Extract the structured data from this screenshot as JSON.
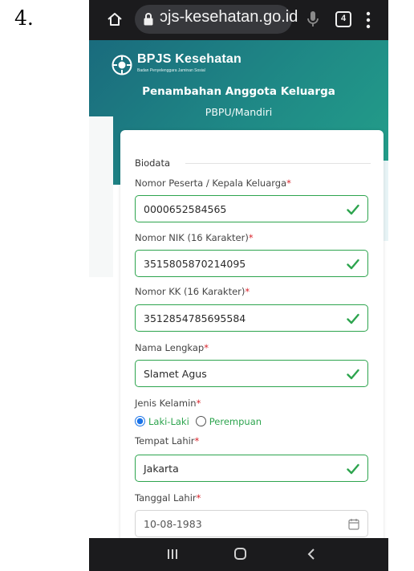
{
  "step_number": "4.",
  "browser": {
    "url": " ɔjs-kesehatan.go.id",
    "tab_count": "4"
  },
  "header": {
    "logo_name": "BPJS Kesehatan",
    "logo_tagline": "Badan Penyelenggara Jaminan Sosial",
    "title": "Penambahan Anggota Keluarga",
    "subtitle": "PBPU/Mandiri"
  },
  "form": {
    "legend": "Biodata",
    "fields": [
      {
        "label": "Nomor Peserta / Kepala Keluarga",
        "required": "*",
        "value": "0000652584565"
      },
      {
        "label": "Nomor NIK (16 Karakter)",
        "required": "*",
        "value": "3515805870214095"
      },
      {
        "label": "Nomor KK (16 Karakter)",
        "required": "*",
        "value": "3512854785695584"
      },
      {
        "label": "Nama Lengkap",
        "required": "*",
        "value": "Slamet Agus"
      }
    ],
    "gender": {
      "label": "Jenis Kelamin",
      "required": "*",
      "options": [
        "Laki-Laki",
        "Perempuan"
      ],
      "selected": "Laki-Laki"
    },
    "birthplace": {
      "label": "Tempat Lahir",
      "required": "*",
      "value": "Jakarta"
    },
    "birthdate": {
      "label": "Tanggal Lahir",
      "required": "*",
      "value": "10-08-1983"
    }
  },
  "colors": {
    "accent_green": "#2da44e",
    "header_teal": "#1f8a86",
    "required_red": "#d9242c",
    "radio_blue": "#1a73e8"
  },
  "icons": {
    "browser": [
      "home-icon",
      "lock-icon",
      "mic-icon",
      "tabs-icon",
      "menu-icon"
    ],
    "nav": [
      "recent-apps-icon",
      "home-nav-icon",
      "back-icon"
    ]
  }
}
